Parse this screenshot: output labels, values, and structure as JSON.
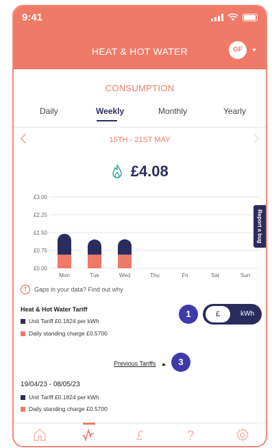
{
  "status": {
    "time": "9:41"
  },
  "header": {
    "title": "HEAT & HOT WATER",
    "avatar_initials": "GF"
  },
  "section": {
    "title": "CONSUMPTION"
  },
  "tabs": [
    {
      "label": "Daily",
      "active": false
    },
    {
      "label": "Weekly",
      "active": true
    },
    {
      "label": "Monthly",
      "active": false
    },
    {
      "label": "Yearly",
      "active": false
    }
  ],
  "period": {
    "label": "15TH - 21ST MAY"
  },
  "total": {
    "amount": "£4.08",
    "icon": "flame-icon"
  },
  "chart_data": {
    "type": "bar",
    "stacked": true,
    "categories": [
      "Mon",
      "Tue",
      "Wed",
      "Thu",
      "Fri",
      "Sat",
      "Sun"
    ],
    "y_ticks": [
      "£3.00",
      "£2.25",
      "£1.50",
      "£0.75",
      "£0.00"
    ],
    "ylim": [
      0,
      3.0
    ],
    "series": [
      {
        "name": "Daily standing charge £0.5700",
        "color": "#ef7a67",
        "values": [
          0.57,
          0.57,
          0.57,
          0,
          0,
          0,
          0
        ]
      },
      {
        "name": "Unit Tariff £0.1824 per kWh",
        "color": "#2a2c5e",
        "values": [
          0.88,
          0.64,
          0.65,
          0,
          0,
          0,
          0
        ]
      }
    ],
    "grid": true
  },
  "report_bug": {
    "label": "Report a bug"
  },
  "gaps": {
    "text": "Gaps in your data? Find out why"
  },
  "tariff": {
    "title": "Heat & Hot Water Tariff",
    "unit_label": "Unit Tariff £0.1824 per kWh",
    "standing_label": "Daily standing charge £0.5700",
    "unit_color": "#2a2c5e",
    "standing_color": "#ef7a67"
  },
  "badges": {
    "toggle_badge": "1",
    "prev_badge": "3"
  },
  "toggle": {
    "pound": "£",
    "kwh": "kWh"
  },
  "previous": {
    "link_label": "Previous Tariffs",
    "date_range": "19/04/23 - 08/05/23",
    "unit_label": "Unit Tariff £0.1824 per kWh",
    "standing_label": "Daily standing charge £0.5700"
  },
  "nav": [
    {
      "icon": "home-icon"
    },
    {
      "icon": "usage-graph-icon",
      "active": true
    },
    {
      "icon": "pound-icon"
    },
    {
      "icon": "help-icon"
    },
    {
      "icon": "settings-icon"
    }
  ],
  "colors": {
    "brand": "#ef7a67",
    "navy": "#2a2c5e",
    "badge": "#3e3aaa"
  }
}
